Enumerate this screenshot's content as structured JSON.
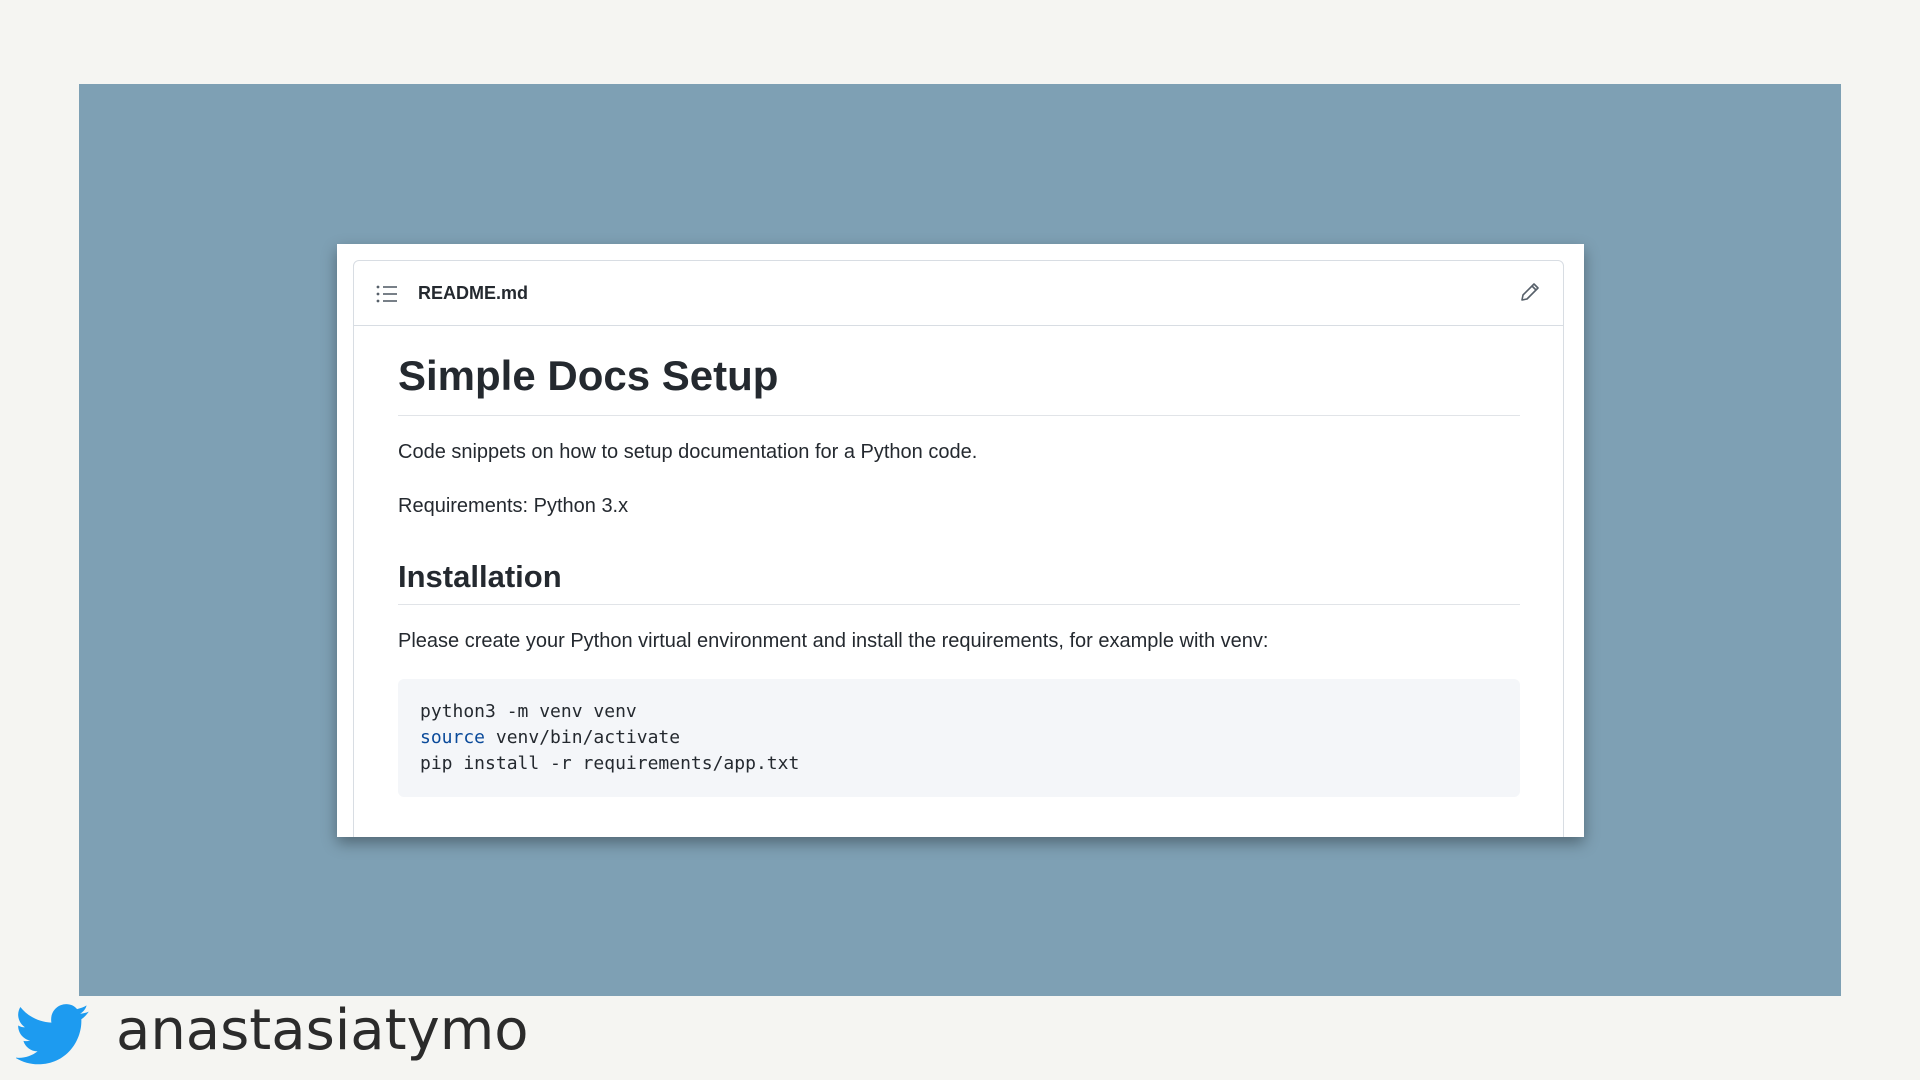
{
  "readme": {
    "file_name": "README.md",
    "title": "Simple Docs Setup",
    "intro": "Code snippets on how to setup documentation for a Python code.",
    "requirements": "Requirements: Python 3.x",
    "installation_heading": "Installation",
    "installation_text": "Please create your Python virtual environment and install the requirements, for example with venv:",
    "code": {
      "line1": "python3 -m venv venv",
      "line2_keyword": "source",
      "line2_rest": " venv/bin/activate",
      "line3": "pip install -r requirements/app.txt"
    }
  },
  "footer": {
    "handle": "anastasiatymo"
  },
  "icons": {
    "header_left": "list-icon",
    "header_right": "pencil-icon",
    "footer": "twitter-bird-icon"
  },
  "colors": {
    "slide_background": "#7ea0b4",
    "page_background": "#f5f5f2",
    "code_keyword": "#0a4a9a",
    "twitter_blue": "#1d9bf0"
  }
}
